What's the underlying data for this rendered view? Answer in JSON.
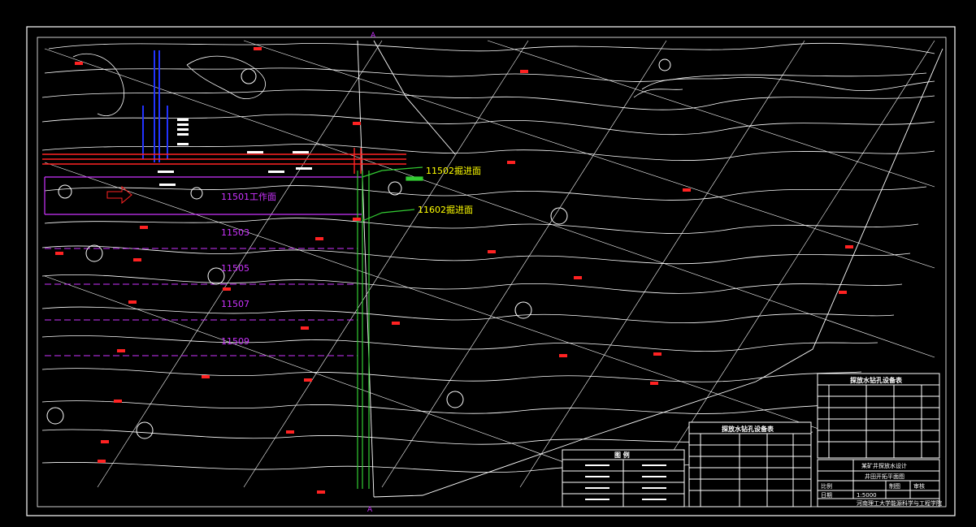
{
  "drawing": {
    "workface_labels": {
      "w11501": "11501工作面",
      "w11503": "11503",
      "w11505": "11505",
      "w11507": "11507",
      "w11509": "11509"
    },
    "face_labels": {
      "f11502": "11502掘进面",
      "f11602": "11602掘进面"
    },
    "section_marks": {
      "top": "A",
      "bottom": "A"
    },
    "legend_table": {
      "title": "图 例"
    },
    "equipment_table_1": {
      "title": "探放水钻孔设备表"
    },
    "equipment_table_2": {
      "title": "探放水钻孔设备表"
    },
    "title_block": {
      "project": "某矿井探放水设计",
      "drawing_name": "井田开拓平面图",
      "scale_label": "比例",
      "scale_value": "1:5000",
      "drawn_label": "制图",
      "check_label": "审核",
      "date_label": "日期",
      "university": "河南理工大学能源科学与工程学院"
    },
    "colors": {
      "background": "#000000",
      "border": "#ffffff",
      "contour": "#ffffff",
      "workface": "#cc33ff",
      "roadway_red": "#ff2222",
      "roadway_green": "#33cc33",
      "face_label": "#ffff00",
      "shaft_blue": "#2233ff"
    }
  }
}
